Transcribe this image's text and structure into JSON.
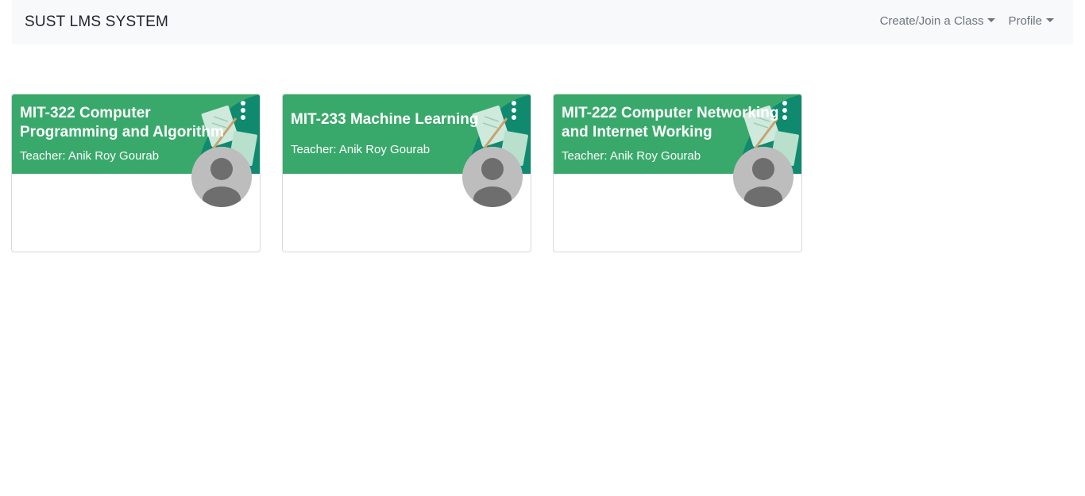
{
  "navbar": {
    "brand": "SUST LMS SYSTEM",
    "menu": [
      {
        "label": "Create/Join a Class",
        "icon": "caret-down-icon"
      },
      {
        "label": "Profile",
        "icon": "caret-down-icon"
      }
    ]
  },
  "classes": [
    {
      "title": "MIT-322 Computer Programming and Algorithm",
      "teacher": "Teacher: Anik Roy Gourab",
      "header_color": "#39a96b",
      "menu_icon": "more-vertical-icon",
      "avatar_icon": "user-avatar-icon"
    },
    {
      "title": "MIT-233 Machine Learning",
      "teacher": "Teacher: Anik Roy Gourab",
      "header_color": "#39a96b",
      "menu_icon": "more-vertical-icon",
      "avatar_icon": "user-avatar-icon"
    },
    {
      "title": "MIT-222 Computer Networking and Internet Working",
      "teacher": "Teacher: Anik Roy Gourab",
      "header_color": "#39a96b",
      "menu_icon": "more-vertical-icon",
      "avatar_icon": "user-avatar-icon"
    }
  ]
}
